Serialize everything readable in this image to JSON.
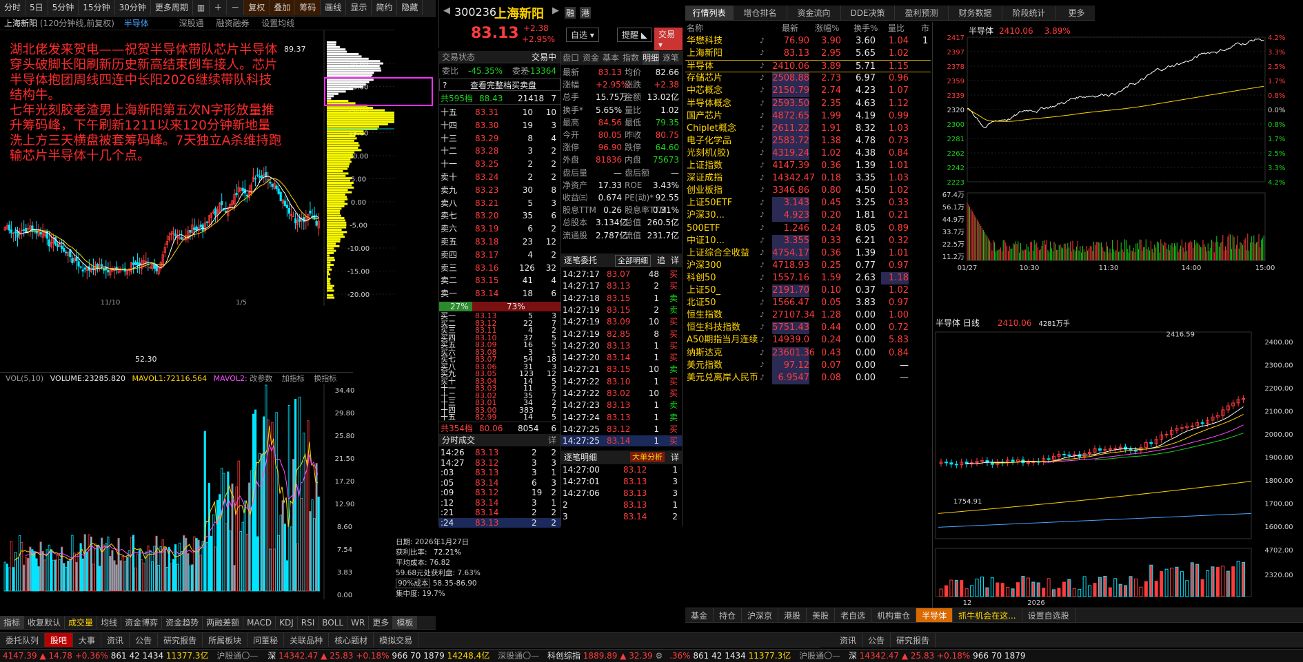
{
  "chart_toolbar": {
    "periods": [
      "分时",
      "5日",
      "5分钟",
      "15分钟",
      "30分钟",
      "更多周期"
    ],
    "tools": [
      "复权",
      "叠加",
      "筹码"
    ],
    "views": [
      "画线",
      "显示",
      "简约",
      "隐藏"
    ]
  },
  "chart_header": {
    "name": "上海新阳",
    "desc": "(120分钟线,前复权)",
    "compare": "半导体",
    "links": [
      "深股通",
      "融资融券",
      "设置均线"
    ]
  },
  "annotation": [
    "湖北佬发来贺电——祝贺半导体带队芯片半导体穿头破脚长阳刷新历史新高结束倒车接人。芯片半导体抱团周线四连中长阳2026继续带队科技结构牛。",
    "七年光刻胶老渣男上海新阳第五次N字形放量推升筹码峰，下午刷新1211以来120分钟新地量洗上方三天横盘被套筹码峰。7天独立A杀维持跑输芯片半导体十几个点。"
  ],
  "price_high_label": "89.37",
  "price_low_label": "52.30",
  "pct_axis": [
    "30.00",
    "25.00",
    "20.00",
    "15.00",
    "10.00",
    "5.00",
    "0.00",
    "-5.00",
    "-10.00",
    "-15.00",
    "-20.00"
  ],
  "x_labels": [
    "11/10",
    "1/5"
  ],
  "vol_header": {
    "vol": "VOL(5,10)",
    "volume": "VOLUME:23285.820",
    "ma1": "MAVOL1:72116.564",
    "ma2": "MAVOL2:",
    "links": [
      "改参数",
      "加指标",
      "换指标"
    ]
  },
  "vol_axis": [
    "34.40",
    "29.80",
    "25.80",
    "21.50",
    "17.20",
    "12.90",
    "8.60",
    "7.54",
    "3.83",
    "0.00"
  ],
  "chip": {
    "date": "日期: 2026年1月27日",
    "profit": "获利比率: ",
    "profit_v": "72.21%",
    "avg": "平均成本: 76.82",
    "avg_profit": "59.68元处获利盘: 7.63%",
    "cost90": "90%成本",
    "cost90_v": "58.35-86.90",
    "conc": "集中度: 19.7%"
  },
  "indicators": [
    "指标",
    "收复默认",
    "成交量",
    "均线",
    "资金博弈",
    "资金趋势",
    "两融差额",
    "MACD",
    "KDJ",
    "RSI",
    "BOLL",
    "WR",
    "更多",
    "模板"
  ],
  "bottom_tabs_left": [
    "委托队列",
    "股吧",
    "大事",
    "资讯",
    "公告",
    "研究报告",
    "所属板块",
    "问董秘",
    "关联品种",
    "核心题材",
    "模拟交易"
  ],
  "stock": {
    "code": "300236",
    "name": "上海新阳",
    "price": "83.13",
    "chg": "+2.38",
    "pct": "+2.95%",
    "tags": [
      "融",
      "港"
    ],
    "buttons": [
      "自选",
      "提醒",
      "交易"
    ]
  },
  "order_header": {
    "title": "交易状态",
    "right": "交易中",
    "ratio_label": "委比",
    "ratio": "-45.35%",
    "diff_label": "委差",
    "diff": "-13364",
    "full": "查看完整档买卖盘",
    "total_sell": "共595档",
    "sell_px": "88.43",
    "sell_vol": "21418",
    "sell_n": "7"
  },
  "asks": [
    [
      "十五",
      "83.31",
      "10",
      "10"
    ],
    [
      "十四",
      "83.30",
      "19",
      "3"
    ],
    [
      "十三",
      "83.29",
      "8",
      "4"
    ],
    [
      "十二",
      "83.28",
      "3",
      "2"
    ],
    [
      "十一",
      "83.25",
      "2",
      "2"
    ],
    [
      "卖十",
      "83.24",
      "2",
      "2"
    ],
    [
      "卖九",
      "83.23",
      "30",
      "8"
    ],
    [
      "卖八",
      "83.21",
      "5",
      "3"
    ],
    [
      "卖七",
      "83.20",
      "35",
      "6"
    ],
    [
      "卖六",
      "83.19",
      "6",
      "2"
    ],
    [
      "卖五",
      "83.18",
      "23",
      "12"
    ],
    [
      "卖四",
      "83.17",
      "4",
      "2"
    ],
    [
      "卖三",
      "83.16",
      "126",
      "32"
    ],
    [
      "卖二",
      "83.15",
      "41",
      "4"
    ],
    [
      "卖一",
      "83.14",
      "18",
      "6"
    ]
  ],
  "ratio_bar": {
    "left": "27%",
    "right": "73%"
  },
  "bids": [
    [
      "买一",
      "83.13",
      "5",
      "3"
    ],
    [
      "买二",
      "83.12",
      "22",
      "7"
    ],
    [
      "买三",
      "83.11",
      "4",
      "2"
    ],
    [
      "买四",
      "83.10",
      "37",
      "5"
    ],
    [
      "买五",
      "83.09",
      "16",
      "5"
    ],
    [
      "买六",
      "83.08",
      "3",
      "1"
    ],
    [
      "买七",
      "83.07",
      "54",
      "18"
    ],
    [
      "买八",
      "83.06",
      "31",
      "3"
    ],
    [
      "买九",
      "83.05",
      "123",
      "12"
    ],
    [
      "买十",
      "83.04",
      "14",
      "5"
    ],
    [
      "十一",
      "83.03",
      "11",
      "2"
    ],
    [
      "十二",
      "83.02",
      "35",
      "7"
    ],
    [
      "十三",
      "83.01",
      "34",
      "2"
    ],
    [
      "十四",
      "83.00",
      "383",
      "7"
    ],
    [
      "十五",
      "82.99",
      "14",
      "5"
    ]
  ],
  "total_buy": {
    "label": "共354档",
    "px": "80.06",
    "vol": "8054",
    "n": "6"
  },
  "ticks_title": "分时成交",
  "ticks": [
    [
      "14:26",
      "83.13",
      "2",
      "2"
    ],
    [
      "14:27",
      "83.12",
      "3",
      "3"
    ],
    [
      ":03",
      "83.13",
      "3",
      "1"
    ],
    [
      ":05",
      "83.14",
      "6",
      "3"
    ],
    [
      ":09",
      "83.12",
      "19",
      "2"
    ],
    [
      ":12",
      "83.14",
      "3",
      "1"
    ],
    [
      ":21",
      "83.14",
      "2",
      "2"
    ],
    [
      ":24",
      "83.13",
      "2",
      "2"
    ]
  ],
  "quote_tabs": [
    "盘口",
    "资金",
    "基本",
    "指数",
    "明细",
    "逐笔"
  ],
  "quote": [
    [
      "最新",
      "83.13",
      "均价",
      "82.66"
    ],
    [
      "涨幅",
      "+2.95%",
      "涨跌",
      "+2.38"
    ],
    [
      "总手",
      "15.75万",
      "金额",
      "13.02亿"
    ],
    [
      "换手*",
      "5.65%",
      "量比",
      "1.02"
    ],
    [
      "最高",
      "84.56",
      "最低",
      "79.35"
    ],
    [
      "今开",
      "80.05",
      "昨收",
      "80.75"
    ],
    [
      "涨停",
      "96.90",
      "跌停",
      "64.60"
    ],
    [
      "外盘",
      "81836",
      "内盘",
      "75673"
    ],
    [
      "盘后量",
      "—",
      "盘后额",
      "—"
    ],
    [
      "净资产",
      "17.33",
      "ROE",
      "3.43%"
    ],
    [
      "收益㈢",
      "0.674",
      "PE(动)*",
      "92.55"
    ],
    [
      "股息TTM",
      "0.26",
      "股息率TTM",
      "0.31%"
    ],
    [
      "总股本",
      "3.134亿",
      "总值",
      "260.5亿"
    ],
    [
      "流通股",
      "2.787亿",
      "流值",
      "231.7亿"
    ]
  ],
  "entrust": {
    "title": "逐笔委托",
    "sel": "全部明细",
    "links": [
      "追",
      "详"
    ],
    "rows": [
      [
        "14:27:17",
        "83.07",
        "48",
        "买"
      ],
      [
        "14:27:17",
        "83.13",
        "2",
        "买"
      ],
      [
        "14:27:18",
        "83.15",
        "1",
        "卖"
      ],
      [
        "14:27:19",
        "83.15",
        "2",
        "卖"
      ],
      [
        "14:27:19",
        "83.09",
        "10",
        "买"
      ],
      [
        "14:27:19",
        "82.85",
        "8",
        "买"
      ],
      [
        "14:27:20",
        "83.13",
        "1",
        "买"
      ],
      [
        "14:27:20",
        "83.14",
        "1",
        "买"
      ],
      [
        "14:27:21",
        "83.15",
        "10",
        "卖"
      ],
      [
        "14:27:22",
        "83.10",
        "1",
        "买"
      ],
      [
        "14:27:22",
        "83.02",
        "10",
        "买"
      ],
      [
        "14:27:23",
        "83.13",
        "1",
        "卖"
      ],
      [
        "14:27:24",
        "83.13",
        "1",
        "卖"
      ],
      [
        "14:27:25",
        "83.12",
        "1",
        "买"
      ],
      [
        "14:27:25",
        "83.14",
        "1",
        "买"
      ]
    ]
  },
  "detail": {
    "title": "逐笔明细",
    "btn": "大单分析",
    "link": "详",
    "rows": [
      [
        "14:27:00",
        "83.12",
        "1"
      ],
      [
        "14:27:01",
        "83.13",
        "3"
      ],
      [
        "14:27:06",
        "83.13",
        "3"
      ],
      [
        "2",
        "83.13",
        "1"
      ],
      [
        "3",
        "83.14",
        "2"
      ],
      [
        "14:27:08",
        "83.13",
        "1"
      ],
      [
        "2",
        "83.12",
        "18"
      ],
      [
        "14:27:12",
        "83.14",
        "3"
      ],
      [
        "14:27:20",
        "83.13",
        "1"
      ],
      [
        "2",
        "83.14",
        "1"
      ],
      [
        "14:27:23",
        "83.13",
        "1"
      ],
      [
        "14:27:24",
        "83.13",
        "1"
      ],
      [
        "14:27:25",
        "83.14",
        "1"
      ]
    ]
  },
  "market_tabs": [
    "行情列表",
    "增仓排名",
    "资金流向",
    "DDE决策",
    "盈利预测",
    "财务数据",
    "阶段统计",
    "更多"
  ],
  "market_headers": [
    "名称",
    "最新",
    "涨幅%",
    "换手%",
    "量比",
    "市"
  ],
  "market": [
    [
      "华懋科技",
      "76.90",
      "3.90",
      "3.60",
      "1.04",
      "1"
    ],
    [
      "上海新阳",
      "83.13",
      "2.95",
      "5.65",
      "1.02",
      ""
    ],
    [
      "半导体",
      "2410.06",
      "3.89",
      "5.71",
      "1.15",
      ""
    ],
    [
      "存储芯片",
      "2508.88",
      "2.73",
      "6.97",
      "0.96",
      ""
    ],
    [
      "中芯概念",
      "2150.79",
      "2.74",
      "4.23",
      "1.07",
      ""
    ],
    [
      "半导体概念",
      "2593.50",
      "2.35",
      "4.63",
      "1.12",
      ""
    ],
    [
      "国产芯片",
      "4872.65",
      "1.99",
      "4.19",
      "0.99",
      ""
    ],
    [
      "Chiplet概念",
      "2611.22",
      "1.91",
      "8.32",
      "1.03",
      ""
    ],
    [
      "电子化学品",
      "2583.72",
      "1.38",
      "4.78",
      "0.73",
      ""
    ],
    [
      "光刻机(胶)",
      "4319.24",
      "1.02",
      "4.38",
      "0.84",
      ""
    ],
    [
      "上证指数",
      "4147.39",
      "0.36",
      "1.39",
      "1.01",
      ""
    ],
    [
      "深证成指",
      "14342.47",
      "0.18",
      "3.35",
      "1.03",
      ""
    ],
    [
      "创业板指",
      "3346.86",
      "0.80",
      "4.50",
      "1.02",
      ""
    ],
    [
      "上证50ETF",
      "3.143",
      "0.45",
      "3.25",
      "0.33",
      ""
    ],
    [
      "沪深30...",
      "4.923",
      "0.20",
      "1.81",
      "0.21",
      ""
    ],
    [
      "500ETF",
      "1.246",
      "0.24",
      "8.05",
      "0.89",
      ""
    ],
    [
      "中证10...",
      "3.355",
      "0.33",
      "6.21",
      "0.32",
      ""
    ],
    [
      "上证综合全收益",
      "4754.17",
      "0.36",
      "1.39",
      "1.01",
      ""
    ],
    [
      "沪深300",
      "4718.93",
      "0.25",
      "0.77",
      "0.97",
      ""
    ],
    [
      "科创50",
      "1557.16",
      "1.59",
      "2.63",
      "1.18",
      ""
    ],
    [
      "上证50_",
      "2191.70",
      "0.10",
      "0.37",
      "1.02",
      ""
    ],
    [
      "北证50",
      "1566.47",
      "0.05",
      "3.83",
      "0.97",
      ""
    ],
    [
      "恒生指数",
      "27107.34",
      "1.28",
      "0.00",
      "1.00",
      ""
    ],
    [
      "恒生科技指数",
      "5751.43",
      "0.44",
      "0.00",
      "0.72",
      ""
    ],
    [
      "A50期指当月连续",
      "14939.0",
      "0.24",
      "0.00",
      "5.83",
      ""
    ],
    [
      "纳斯达克",
      "23601.36",
      "0.43",
      "0.00",
      "0.84",
      ""
    ],
    [
      "美元指数",
      "97.12",
      "0.07",
      "0.00",
      "—",
      ""
    ],
    [
      "美元兑离岸人民币",
      "6.9547",
      "0.08",
      "0.00",
      "—",
      ""
    ]
  ],
  "market_bottom_tabs": [
    "基金",
    "持仓",
    "沪深京",
    "港股",
    "美股",
    "老自选",
    "机构重仓",
    "半导体",
    "抓牛机会在这...",
    "设置自选股"
  ],
  "mini": {
    "name": "半导体",
    "price": "2410.06",
    "pct": "3.89%",
    "y_left": [
      "2417",
      "2397",
      "2378",
      "2359",
      "2339",
      "2320",
      "2300",
      "2281",
      "2262",
      "2242",
      "2223"
    ],
    "y_right": [
      "4.2%",
      "3.3%",
      "2.5%",
      "1.7%",
      "0.8%",
      "0.0%",
      "0.8%",
      "1.7%",
      "2.5%",
      "3.3%",
      "4.2%"
    ],
    "vol_axis": [
      "67.4万",
      "56.1万",
      "44.9万",
      "33.7万",
      "22.5万",
      "11.2万"
    ],
    "x_labels": [
      "01/27",
      "10:30",
      "11:30",
      "14:00",
      "15:00"
    ]
  },
  "daily": {
    "title": "半导体 日线",
    "price": "2410.06",
    "vol": "4281万手",
    "high": "2416.59",
    "low": "1754.91",
    "y": [
      "2400.00",
      "2300.00",
      "2200.00",
      "2100.00",
      "2000.00",
      "1900.00",
      "1800.00",
      "1700.00",
      "1600.00"
    ],
    "vol_y": [
      "4702.00",
      "2320.00"
    ],
    "x": [
      "12",
      "2026"
    ]
  },
  "right_bottom_tabs": [
    "资讯",
    "公告",
    "研究报告"
  ],
  "status": {
    "sh": "4147.39",
    "sh_chg": "▲ 14.78",
    "sh_pct": "+0.36%",
    "sh_vol": "861",
    "sh_n1": "42",
    "sh_n2": "1434",
    "sh_amt": "11377.3亿",
    "sh_link": "沪股通",
    "sz_label": "深",
    "sz": "14342.47",
    "sz_chg": "▲ 25.83",
    "sz_pct": "+0.18%",
    "sz_vol": "966",
    "sz_n1": "70",
    "sz_n2": "1879",
    "sz_amt": "14248.4亿",
    "sz_link": "深股通",
    "kc_label": "科创综指",
    "kc": "1889.89",
    "kc_chg": "▲ 32.39",
    "r_pct": ".36%",
    "r_vol": "861",
    "r_n1": "42",
    "r_n2": "1434",
    "r_amt": "11377.3亿",
    "r_link": "沪股通",
    "r_sz": "深",
    "r_szv": "14342.47",
    "r_szc": "▲ 25.83",
    "r_szp": "+0.18%",
    "r_szvol": "966",
    "r_szn1": "70",
    "r_szn2": "1879"
  },
  "colors": {
    "up": "#ff3b3b",
    "down": "#1ad41a",
    "volume": "#00e5ff",
    "annotation": "#ff2a2a",
    "chip": "#ffff00"
  }
}
